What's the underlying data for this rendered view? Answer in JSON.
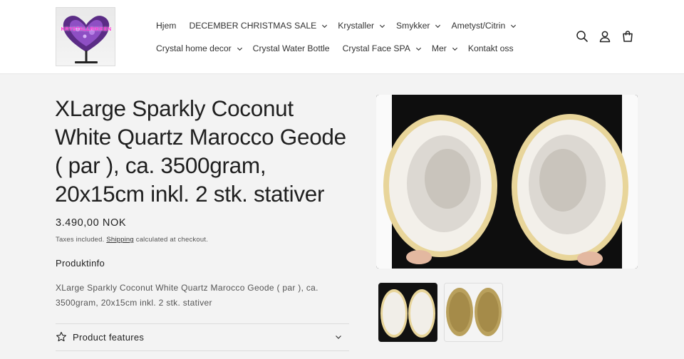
{
  "header": {
    "logo_text": "KRYSTALLRIKKEN",
    "nav_row1": [
      {
        "label": "Hjem",
        "has_dropdown": false
      },
      {
        "label": "DECEMBER CHRISTMAS SALE",
        "has_dropdown": true
      },
      {
        "label": "Krystaller",
        "has_dropdown": true
      },
      {
        "label": "Smykker",
        "has_dropdown": true
      },
      {
        "label": "Ametyst/Citrin",
        "has_dropdown": true
      }
    ],
    "nav_row2": [
      {
        "label": "Crystal home decor",
        "has_dropdown": true
      },
      {
        "label": "Crystal Water Bottle",
        "has_dropdown": false
      },
      {
        "label": "Crystal Face SPA",
        "has_dropdown": true
      },
      {
        "label": "Mer",
        "has_dropdown": true
      },
      {
        "label": "Kontakt oss",
        "has_dropdown": false
      }
    ],
    "icons": [
      "search-icon",
      "account-icon",
      "cart-icon"
    ]
  },
  "product": {
    "title": "XLarge Sparkly Coconut White Quartz Marocco Geode ( par ), ca. 3500gram, 20x15cm inkl. 2 stk. stativer",
    "price": "3.490,00 NOK",
    "tax_prefix": "Taxes included.",
    "tax_link": "Shipping",
    "tax_suffix": "calculated at checkout.",
    "info_heading": "Produktinfo",
    "description": "XLarge Sparkly Coconut White Quartz Marocco Geode ( par ), ca. 3500gram, 20x15cm inkl. 2 stk. stativer",
    "features_label": "Product features"
  },
  "colors": {
    "accent_logo": "#ff2bd6",
    "page_bg": "#f3f3f3",
    "header_bg": "#ffffff"
  }
}
